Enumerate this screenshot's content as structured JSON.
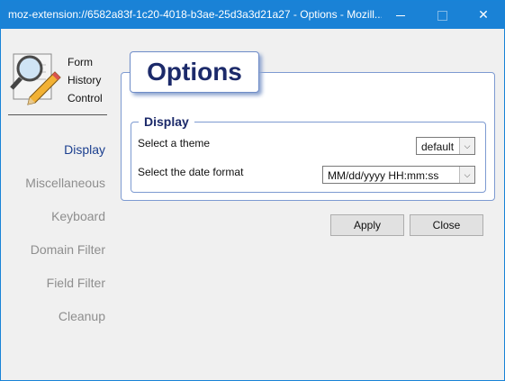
{
  "window": {
    "title": "moz-extension://6582a83f-1c20-4018-b3ae-25d3a3d21a27 - Options - Mozill...",
    "controls": {
      "minimize": "minimize",
      "maximize": "maximize",
      "close": "✕"
    }
  },
  "sidebar": {
    "logo_text": [
      "Form",
      "History",
      "Control"
    ],
    "items": [
      {
        "label": "Display",
        "active": true
      },
      {
        "label": "Miscellaneous",
        "active": false
      },
      {
        "label": "Keyboard",
        "active": false
      },
      {
        "label": "Domain Filter",
        "active": false
      },
      {
        "label": "Field Filter",
        "active": false
      },
      {
        "label": "Cleanup",
        "active": false
      }
    ]
  },
  "main": {
    "heading": "Options",
    "fieldset": {
      "legend": "Display",
      "theme_label": "Select a theme",
      "theme_value": "default",
      "date_label": "Select the date format",
      "date_value": "MM/dd/yyyy HH:mm:ss"
    },
    "buttons": {
      "apply": "Apply",
      "close": "Close"
    }
  },
  "colors": {
    "titlebar": "#1a82d6",
    "accent": "#1b3f8f",
    "heading": "#1c2a6a"
  }
}
